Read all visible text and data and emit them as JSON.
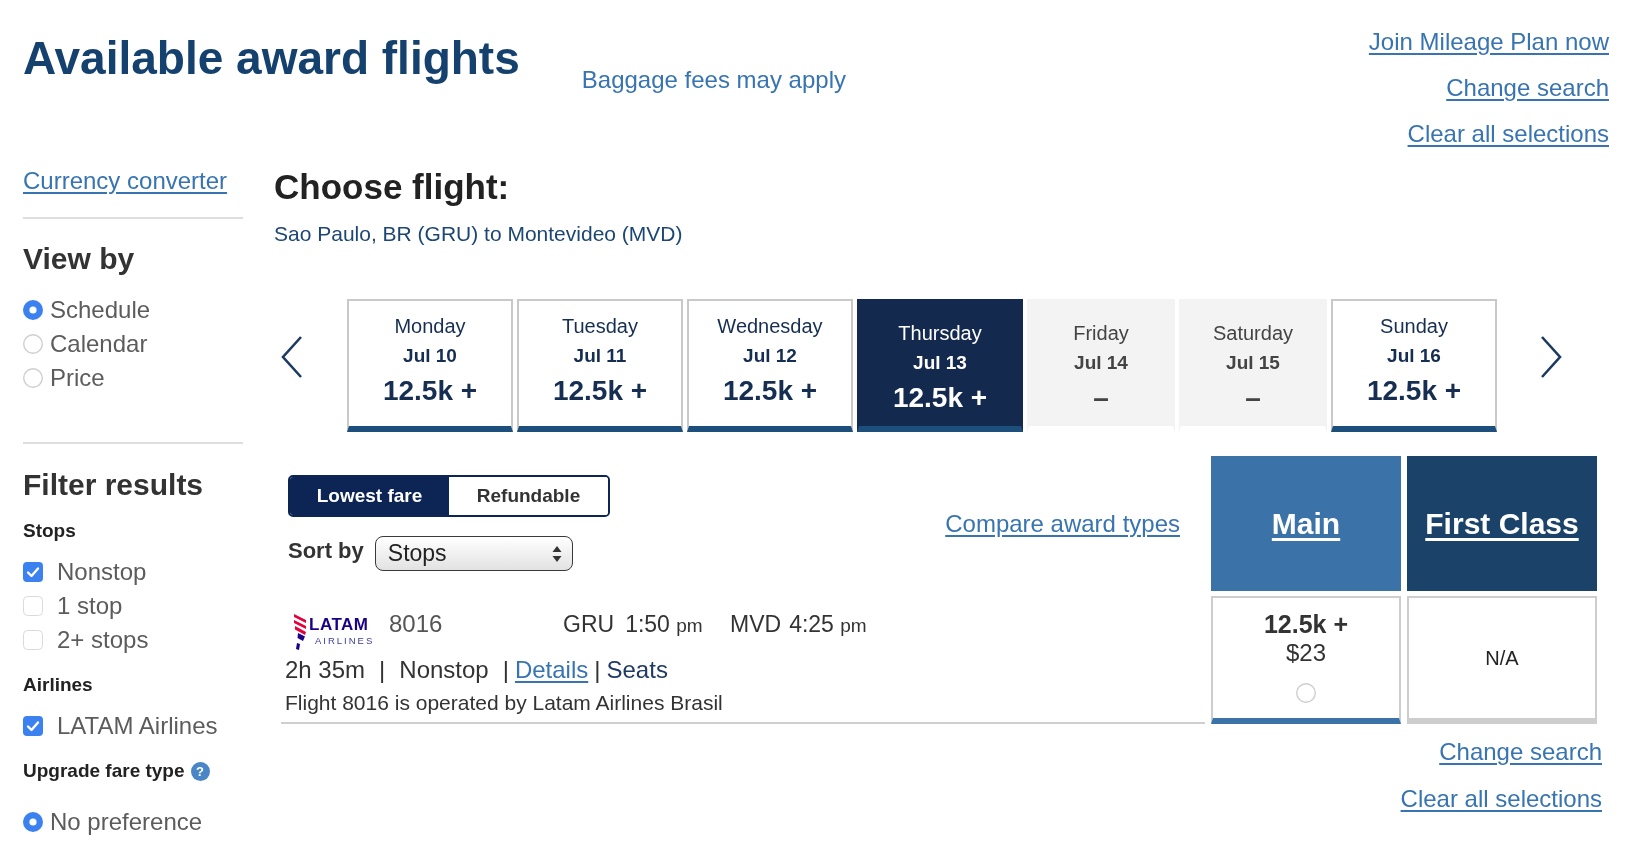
{
  "header": {
    "title": "Available award flights",
    "baggage_link": "Baggage fees may apply",
    "links": [
      "Join Mileage Plan now",
      "Change search",
      "Clear all selections"
    ]
  },
  "sidebar": {
    "currency_link": "Currency converter",
    "view_by": {
      "title": "View by",
      "options": [
        {
          "label": "Schedule",
          "selected": true
        },
        {
          "label": "Calendar",
          "selected": false
        },
        {
          "label": "Price",
          "selected": false
        }
      ]
    },
    "filters": {
      "title": "Filter results",
      "groups": [
        {
          "title": "Stops",
          "kind": "checkbox",
          "options": [
            {
              "label": "Nonstop",
              "checked": true
            },
            {
              "label": "1 stop",
              "checked": false
            },
            {
              "label": "2+ stops",
              "checked": false
            }
          ]
        },
        {
          "title": "Airlines",
          "kind": "checkbox",
          "options": [
            {
              "label": "LATAM Airlines",
              "checked": true
            }
          ]
        },
        {
          "title": "Upgrade fare type",
          "kind": "radio",
          "help": "?",
          "options": [
            {
              "label": "No preference",
              "selected": true
            }
          ]
        }
      ]
    }
  },
  "main": {
    "title": "Choose flight:",
    "route": "Sao Paulo, BR (GRU) to Montevideo (MVD)",
    "dates": [
      {
        "weekday": "Monday",
        "date": "Jul 10",
        "price": "12.5k +",
        "available": true,
        "selected": false
      },
      {
        "weekday": "Tuesday",
        "date": "Jul 11",
        "price": "12.5k +",
        "available": true,
        "selected": false
      },
      {
        "weekday": "Wednesday",
        "date": "Jul 12",
        "price": "12.5k +",
        "available": true,
        "selected": false
      },
      {
        "weekday": "Thursday",
        "date": "Jul 13",
        "price": "12.5k +",
        "available": true,
        "selected": true
      },
      {
        "weekday": "Friday",
        "date": "Jul 14",
        "price": "–",
        "available": false,
        "selected": false
      },
      {
        "weekday": "Saturday",
        "date": "Jul 15",
        "price": "–",
        "available": false,
        "selected": false
      },
      {
        "weekday": "Sunday",
        "date": "Jul 16",
        "price": "12.5k +",
        "available": true,
        "selected": false
      }
    ],
    "fare_filter": [
      {
        "label": "Lowest fare",
        "selected": true
      },
      {
        "label": "Refundable",
        "selected": false
      }
    ],
    "sort": {
      "label": "Sort by",
      "value": "Stops"
    },
    "compare_link": "Compare award types",
    "fare_columns": [
      {
        "label": "Main",
        "color": "#3b73a9"
      },
      {
        "label": "First Class",
        "color": "#1b4268"
      }
    ],
    "flights": [
      {
        "logo": {
          "name": "LATAM",
          "subtitle": "AIRLINES"
        },
        "number": "8016",
        "departure": {
          "airport": "GRU",
          "time": "1:50",
          "period": "pm"
        },
        "arrival": {
          "airport": "MVD",
          "time": "4:25",
          "period": "pm"
        },
        "details": [
          {
            "kind": "text",
            "text": "2h 35m"
          },
          {
            "kind": "separator",
            "text": "|"
          },
          {
            "kind": "text",
            "text": "Nonstop"
          },
          {
            "kind": "separator",
            "text": "|"
          },
          {
            "kind": "link",
            "text": "Details"
          },
          {
            "kind": "separator",
            "text": "|"
          },
          {
            "kind": "action",
            "text": "Seats"
          }
        ],
        "operated_by": "Flight 8016 is operated by Latam Airlines Brasil",
        "fares": [
          {
            "kind": "price",
            "miles": "12.5k +",
            "cash": "$23",
            "selected": false
          },
          {
            "kind": "unavailable",
            "text": "N/A"
          }
        ]
      }
    ],
    "footer_links": [
      "Change search",
      "Clear all selections"
    ]
  }
}
